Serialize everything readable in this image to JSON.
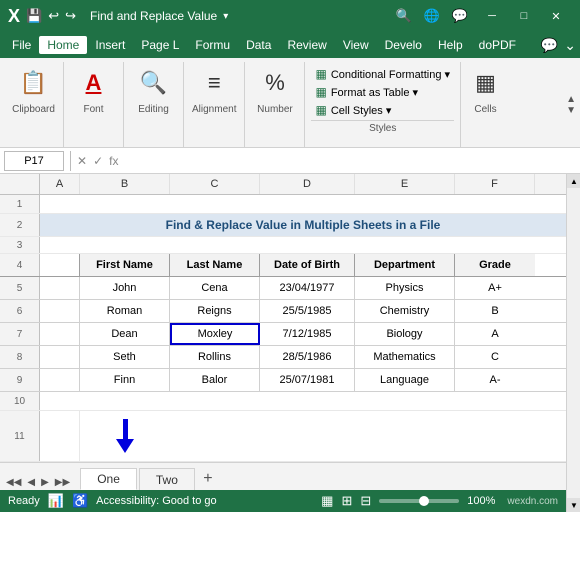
{
  "titleBar": {
    "title": "Find and Replace Value",
    "icons": [
      "search",
      "globe",
      "edit",
      "restore",
      "minimize",
      "maximize",
      "close"
    ]
  },
  "menuBar": {
    "items": [
      "File",
      "Home",
      "Insert",
      "Page L",
      "Formu",
      "Data",
      "Review",
      "View",
      "Develo",
      "Help",
      "doPDF"
    ]
  },
  "ribbon": {
    "groups": [
      {
        "label": "Clipboard",
        "icon": "📋"
      },
      {
        "label": "Font",
        "icon": "A"
      },
      {
        "label": "Editing",
        "icon": "🔍"
      },
      {
        "label": "Alignment",
        "icon": "≡"
      },
      {
        "label": "Number",
        "icon": "%"
      }
    ],
    "stylesGroup": {
      "title": "Styles",
      "items": [
        "Conditional Formatting ▾",
        "Format as Table ▾",
        "Cell Styles ▾"
      ]
    },
    "cellsGroup": {
      "label": "Cells",
      "icon": "▦"
    }
  },
  "formulaBar": {
    "nameBox": "P17",
    "formula": ""
  },
  "spreadsheet": {
    "colHeaders": [
      "",
      "A",
      "B",
      "C",
      "D",
      "E",
      "F"
    ],
    "sheetTitle": "Find & Replace Value in Multiple Sheets in a File",
    "tableHeaders": [
      "First Name",
      "Last Name",
      "Date of Birth",
      "Department",
      "Grade"
    ],
    "tableRows": [
      [
        "John",
        "Cena",
        "23/04/1977",
        "Physics",
        "A+"
      ],
      [
        "Roman",
        "Reigns",
        "25/5/1985",
        "Chemistry",
        "B"
      ],
      [
        "Dean",
        "Moxley",
        "7/12/1985",
        "Biology",
        "A"
      ],
      [
        "Seth",
        "Rollins",
        "28/5/1986",
        "Mathematics",
        "C"
      ],
      [
        "Finn",
        "Balor",
        "25/07/1981",
        "Language",
        "A-"
      ]
    ],
    "highlightedCell": "Moxley"
  },
  "sheetTabs": {
    "tabs": [
      "One",
      "Two"
    ],
    "activeTab": "One",
    "addButton": "+"
  },
  "statusBar": {
    "ready": "Ready",
    "accessibility": "Accessibility: Good to go",
    "zoomLevel": "100%",
    "watermark": "wexdn.com"
  }
}
